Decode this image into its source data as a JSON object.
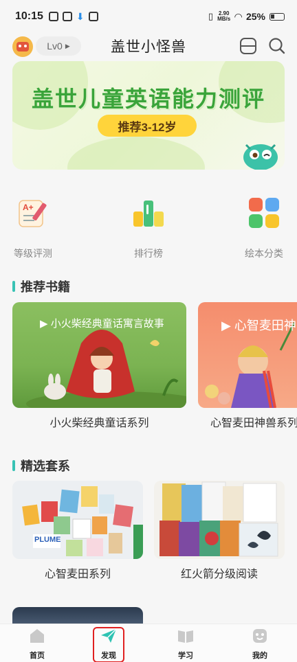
{
  "status_bar": {
    "time": "10:15",
    "net_speed_value": "2.90",
    "net_speed_unit": "MB/s",
    "battery": "25%"
  },
  "header": {
    "title": "盖世小怪兽",
    "level": "Lv0"
  },
  "banner": {
    "title": "盖世儿童英语能力测评",
    "pill": "推荐3-12岁"
  },
  "quick_nav": [
    {
      "label": "等级评测"
    },
    {
      "label": "排行榜"
    },
    {
      "label": "绘本分类"
    }
  ],
  "sections": {
    "recommended": "推荐书籍",
    "featured_sets": "精选套系"
  },
  "recommended_books": [
    {
      "tag": "▶ 小火柴经典童话寓言故事",
      "caption": "小火柴经典童话系列"
    },
    {
      "tag": "▶ 心智麦田神",
      "caption": "心智麦田神兽系列"
    }
  ],
  "featured_sets": [
    {
      "caption": "心智麦田系列",
      "cover_word": "PLUME"
    },
    {
      "caption": "红火箭分级阅读"
    }
  ],
  "bottom_nav": [
    {
      "label": "首页"
    },
    {
      "label": "发现"
    },
    {
      "label": "学习"
    },
    {
      "label": "我的"
    }
  ]
}
